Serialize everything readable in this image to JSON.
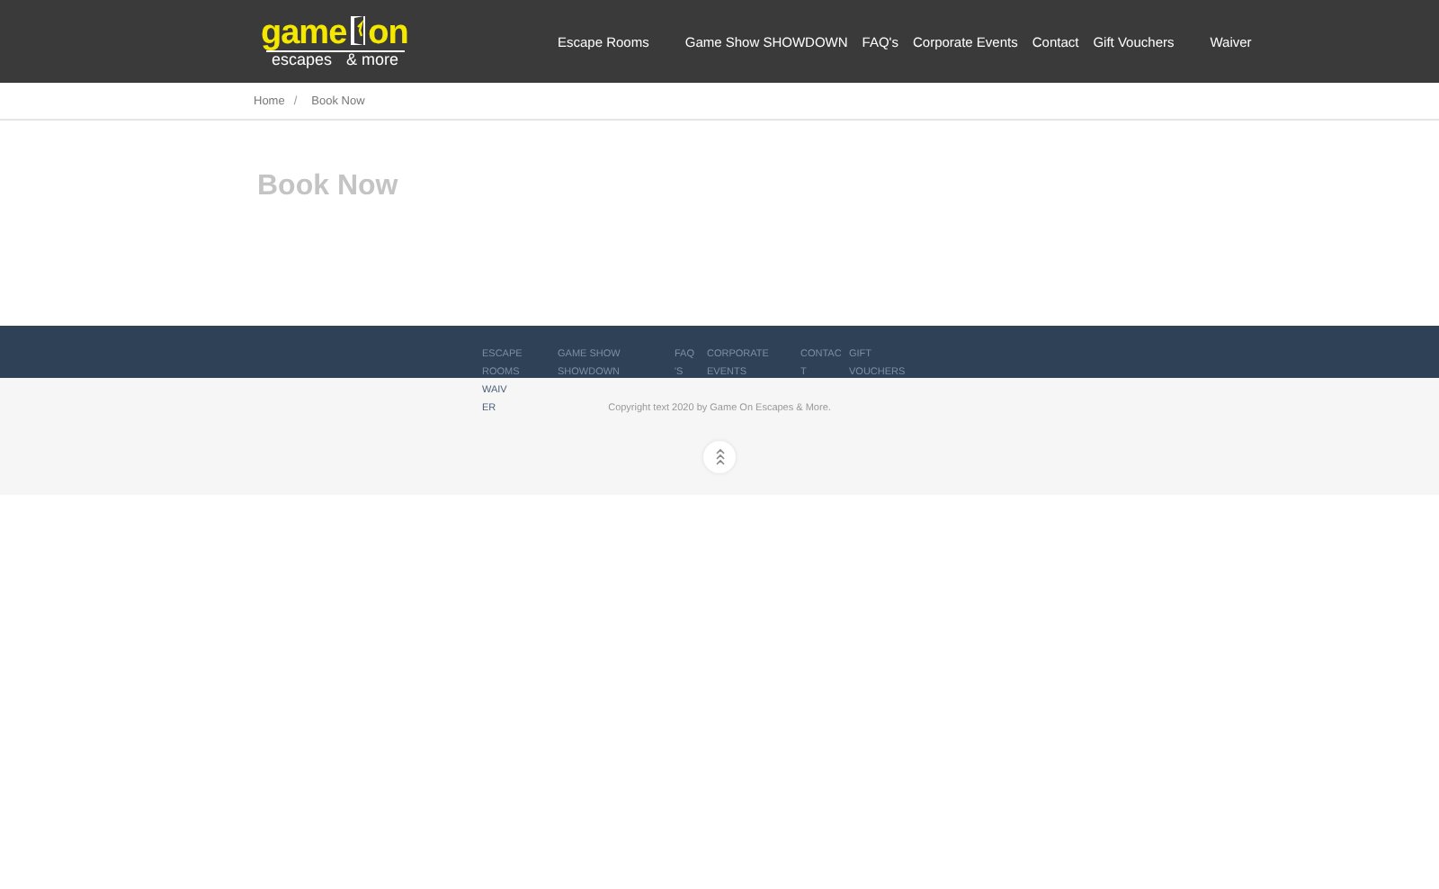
{
  "logo": {
    "word_1": "game",
    "word_2": "on",
    "tagline_1": "escapes",
    "tagline_2": "& more"
  },
  "nav": [
    {
      "label": "Escape Rooms"
    },
    {
      "label": "Game Show SHOWDOWN"
    },
    {
      "label": "FAQ's"
    },
    {
      "label": "Corporate Events"
    },
    {
      "label": "Contact"
    },
    {
      "label": "Gift Vouchers"
    },
    {
      "label": "Waiver"
    }
  ],
  "breadcrumb": [
    {
      "label": "Home"
    },
    {
      "label": "Book Now"
    }
  ],
  "breadcrumb_separator": "/",
  "page_title": "Book Now",
  "footer_nav": [
    {
      "label": "ESCAPE ROOMS"
    },
    {
      "label": "GAME SHOW SHOWDOWN"
    },
    {
      "label": "FAQ'S"
    },
    {
      "label": "CORPORATE EVENTS"
    },
    {
      "label": "CONTACT"
    },
    {
      "label": "GIFT VOUCHERS"
    },
    {
      "label": "WAIVER"
    }
  ],
  "copyright": "Copyright text 2020 by Game On Escapes & More."
}
